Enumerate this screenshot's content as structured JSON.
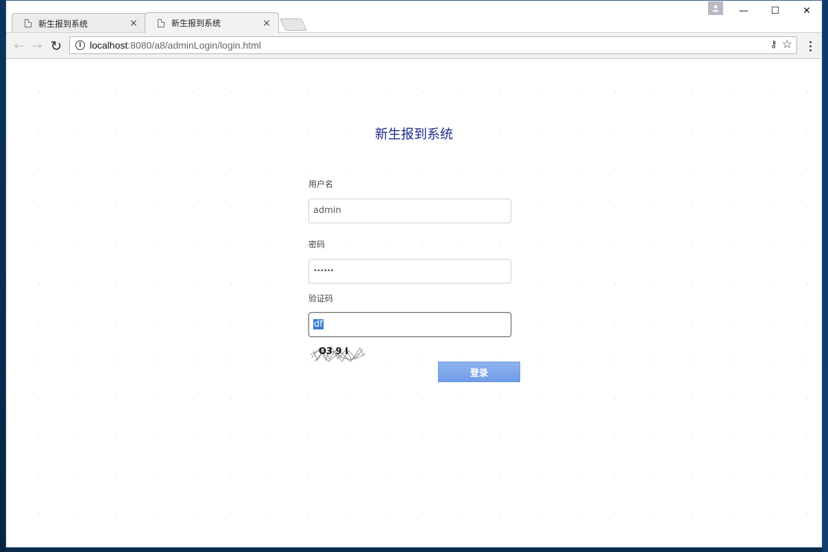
{
  "browser": {
    "tabs": [
      {
        "title": "新生报到系统",
        "close": "×",
        "active": false
      },
      {
        "title": "新生报到系统",
        "close": "×",
        "active": true
      }
    ],
    "window_controls": {
      "minimize": "—",
      "maximize": "☐",
      "close": "✕"
    },
    "toolbar": {
      "back": "←",
      "forward": "→",
      "reload": "↻",
      "info": "i",
      "url_host": "localhost",
      "url_rest": ":8080/a8/adminLogin/login.html",
      "key": "⚷",
      "star": "☆"
    }
  },
  "login": {
    "title": "新生报到系统",
    "username_label": "用户名",
    "username_value": "admin",
    "password_label": "密码",
    "password_value": "••••••",
    "captcha_label": "验证码",
    "captcha_value": "df",
    "captcha_image_text": "O3 9 I",
    "submit_label": "登录"
  },
  "colors": {
    "title": "#1d2a8a",
    "button": "#7aa6ec",
    "selection": "#3a7bd5"
  },
  "icons": [
    "page-icon",
    "close-icon",
    "profile-icon",
    "minimize-icon",
    "maximize-icon",
    "window-close-icon",
    "back-icon",
    "forward-icon",
    "reload-icon",
    "info-icon",
    "key-icon",
    "star-icon",
    "menu-icon"
  ]
}
